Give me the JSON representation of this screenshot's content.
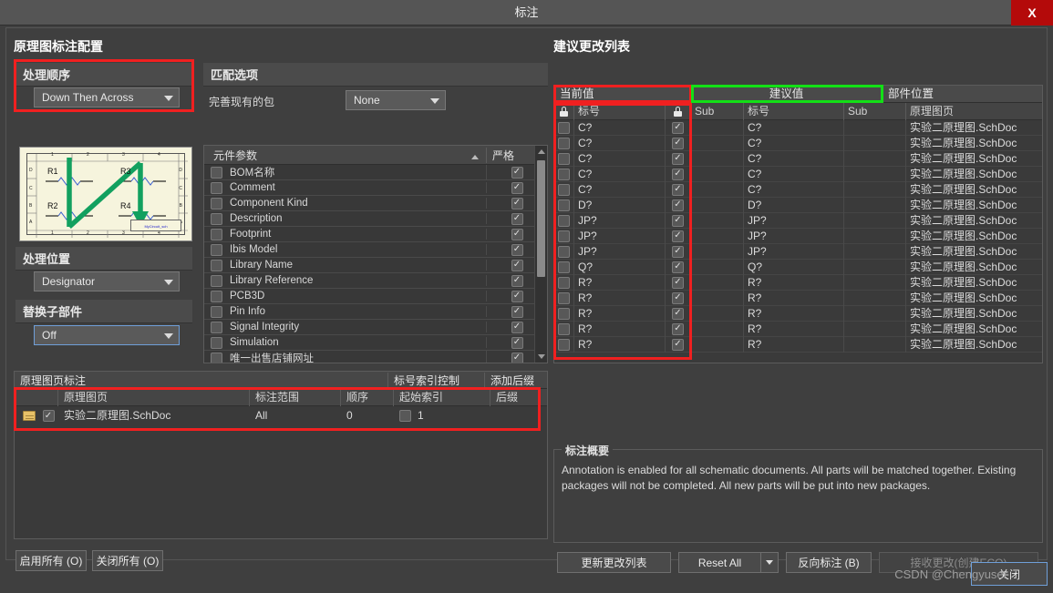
{
  "window": {
    "title": "标注",
    "close_icon": "close-icon",
    "close_label": "X"
  },
  "left": {
    "caption": "原理图标注配置",
    "order_section": {
      "header": "处理顺序",
      "value": "Down Then Across"
    },
    "schematic_preview": {
      "parts": [
        "R1",
        "R3",
        "R2",
        "R4"
      ],
      "col_labels": [
        "1",
        "2",
        "3",
        "4"
      ],
      "row_labels": [
        "D",
        "C",
        "B",
        "A"
      ],
      "title_block": "MyCircuit_sch"
    },
    "location_section": {
      "header": "处理位置",
      "value": "Designator"
    },
    "subpart_section": {
      "header": "替换子部件",
      "value": "Off"
    },
    "buttons": {
      "enable_all": "启用所有 (O)",
      "disable_all": "关闭所有 (O)"
    }
  },
  "match": {
    "header": "匹配选项",
    "pack_label": "完善现有的包",
    "pack_value": "None",
    "columns": [
      "元件参数",
      "严格"
    ],
    "rows": [
      {
        "name": "BOM名称",
        "checked": false,
        "strict": true
      },
      {
        "name": "Comment",
        "checked": false,
        "strict": true
      },
      {
        "name": "Component Kind",
        "checked": false,
        "strict": true
      },
      {
        "name": "Description",
        "checked": false,
        "strict": true
      },
      {
        "name": "Footprint",
        "checked": false,
        "strict": true
      },
      {
        "name": "Ibis Model",
        "checked": false,
        "strict": true
      },
      {
        "name": "Library Name",
        "checked": false,
        "strict": true
      },
      {
        "name": "Library Reference",
        "checked": false,
        "strict": true
      },
      {
        "name": "PCB3D",
        "checked": false,
        "strict": true
      },
      {
        "name": "Pin Info",
        "checked": false,
        "strict": true
      },
      {
        "name": "Signal Integrity",
        "checked": false,
        "strict": true
      },
      {
        "name": "Simulation",
        "checked": false,
        "strict": true
      },
      {
        "name": "唯一出售店铺网址",
        "checked": false,
        "strict": true
      }
    ]
  },
  "sheets": {
    "group_headers": [
      "原理图页标注",
      "标号索引控制",
      "添加后缀"
    ],
    "columns": [
      "原理图页",
      "标注范围",
      "顺序",
      "起始索引",
      "后缀"
    ],
    "rows": [
      {
        "icon": "folder-icon",
        "enabled": true,
        "sheet": "实验二原理图.SchDoc",
        "scope": "All",
        "order": "0",
        "index_checked": false,
        "start_index": "1",
        "suffix": ""
      }
    ]
  },
  "changes": {
    "caption": "建议更改列表",
    "group_headers": [
      "当前值",
      "建议值",
      "部件位置"
    ],
    "columns": [
      "lock-icon",
      "标号",
      "lock-icon",
      "Sub",
      "标号",
      "Sub",
      "原理图页"
    ],
    "rows": [
      {
        "current": "C?",
        "accept": true,
        "sub_cur": "",
        "proposed": "C?",
        "sub_new": "",
        "sheet": "实验二原理图.SchDoc"
      },
      {
        "current": "C?",
        "accept": true,
        "sub_cur": "",
        "proposed": "C?",
        "sub_new": "",
        "sheet": "实验二原理图.SchDoc"
      },
      {
        "current": "C?",
        "accept": true,
        "sub_cur": "",
        "proposed": "C?",
        "sub_new": "",
        "sheet": "实验二原理图.SchDoc"
      },
      {
        "current": "C?",
        "accept": true,
        "sub_cur": "",
        "proposed": "C?",
        "sub_new": "",
        "sheet": "实验二原理图.SchDoc"
      },
      {
        "current": "C?",
        "accept": true,
        "sub_cur": "",
        "proposed": "C?",
        "sub_new": "",
        "sheet": "实验二原理图.SchDoc"
      },
      {
        "current": "D?",
        "accept": true,
        "sub_cur": "",
        "proposed": "D?",
        "sub_new": "",
        "sheet": "实验二原理图.SchDoc"
      },
      {
        "current": "JP?",
        "accept": true,
        "sub_cur": "",
        "proposed": "JP?",
        "sub_new": "",
        "sheet": "实验二原理图.SchDoc"
      },
      {
        "current": "JP?",
        "accept": true,
        "sub_cur": "",
        "proposed": "JP?",
        "sub_new": "",
        "sheet": "实验二原理图.SchDoc"
      },
      {
        "current": "JP?",
        "accept": true,
        "sub_cur": "",
        "proposed": "JP?",
        "sub_new": "",
        "sheet": "实验二原理图.SchDoc"
      },
      {
        "current": "Q?",
        "accept": true,
        "sub_cur": "",
        "proposed": "Q?",
        "sub_new": "",
        "sheet": "实验二原理图.SchDoc"
      },
      {
        "current": "R?",
        "accept": true,
        "sub_cur": "",
        "proposed": "R?",
        "sub_new": "",
        "sheet": "实验二原理图.SchDoc"
      },
      {
        "current": "R?",
        "accept": true,
        "sub_cur": "",
        "proposed": "R?",
        "sub_new": "",
        "sheet": "实验二原理图.SchDoc"
      },
      {
        "current": "R?",
        "accept": true,
        "sub_cur": "",
        "proposed": "R?",
        "sub_new": "",
        "sheet": "实验二原理图.SchDoc"
      },
      {
        "current": "R?",
        "accept": true,
        "sub_cur": "",
        "proposed": "R?",
        "sub_new": "",
        "sheet": "实验二原理图.SchDoc"
      },
      {
        "current": "R?",
        "accept": true,
        "sub_cur": "",
        "proposed": "R?",
        "sub_new": "",
        "sheet": "实验二原理图.SchDoc"
      }
    ]
  },
  "summary": {
    "legend": "标注概要",
    "text": "Annotation is enabled for all schematic documents. All parts will be matched together. Existing packages will not be completed. All new parts will be put into new packages."
  },
  "actions": {
    "update_list": "更新更改列表",
    "reset_all": "Reset All",
    "back_annotate": "反向标注 (B)",
    "accept_changes": "接收更改(创建ECO)",
    "close": "关闭"
  },
  "watermark": "CSDN @Chengyuser",
  "colors": {
    "highlight_red": "#f02020",
    "highlight_green": "#13e016",
    "accent_blue": "#6f9fd8",
    "close_red": "#b40a0a",
    "schematic_green": "#12a05f",
    "schematic_paper": "#f6f4dd"
  }
}
